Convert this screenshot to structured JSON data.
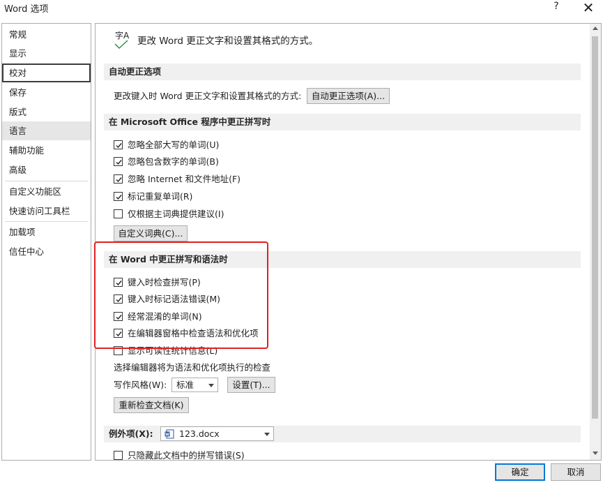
{
  "window": {
    "title": "Word 选项",
    "help_label": "?",
    "close_label": "✕"
  },
  "nav": {
    "items": [
      {
        "label": "常规"
      },
      {
        "label": "显示"
      },
      {
        "label": "校对"
      },
      {
        "label": "保存"
      },
      {
        "label": "版式"
      },
      {
        "label": "语言"
      },
      {
        "label": "辅助功能"
      },
      {
        "label": "高级"
      },
      {
        "label": "自定义功能区"
      },
      {
        "label": "快速访问工具栏"
      },
      {
        "label": "加载项"
      },
      {
        "label": "信任中心"
      }
    ],
    "selected": "校对"
  },
  "header": {
    "icon_glyph": "字A",
    "text": "更改 Word 更正文字和设置其格式的方式。"
  },
  "autocorrect": {
    "section_title": "自动更正选项",
    "row_label": "更改键入时 Word 更正文字和设置其格式的方式:",
    "button": "自动更正选项(A)..."
  },
  "office": {
    "section_title": "在 Microsoft Office 程序中更正拼写时",
    "options": [
      {
        "label": "忽略全部大写的单词(U)",
        "checked": true
      },
      {
        "label": "忽略包含数字的单词(B)",
        "checked": true
      },
      {
        "label": "忽略 Internet 和文件地址(F)",
        "checked": true
      },
      {
        "label": "标记重复单词(R)",
        "checked": true
      },
      {
        "label": "仅根据主词典提供建议(I)",
        "checked": false
      }
    ],
    "dict_button": "自定义词典(C)..."
  },
  "word": {
    "section_title": "在 Word 中更正拼写和语法时",
    "options": [
      {
        "label": "键入时检查拼写(P)",
        "checked": true
      },
      {
        "label": "键入时标记语法错误(M)",
        "checked": true
      },
      {
        "label": "经常混淆的单词(N)",
        "checked": true
      },
      {
        "label": "在编辑器窗格中检查语法和优化项",
        "checked": true
      },
      {
        "label": "显示可读性统计信息(L)",
        "checked": false
      }
    ],
    "editor_text": "选择编辑器将为语法和优化项执行的检查",
    "style_label": "写作风格(W):",
    "style_value": "标准",
    "settings_button": "设置(T)...",
    "recheck_button": "重新检查文档(K)"
  },
  "exceptions": {
    "label": "例外项(X):",
    "file": "123.docx",
    "option_label": "只隐藏此文档中的拼写错误(S)"
  },
  "footer": {
    "ok": "确定",
    "cancel": "取消"
  },
  "colors": {
    "highlight": "#e02020",
    "primary_border": "#0078d7"
  }
}
